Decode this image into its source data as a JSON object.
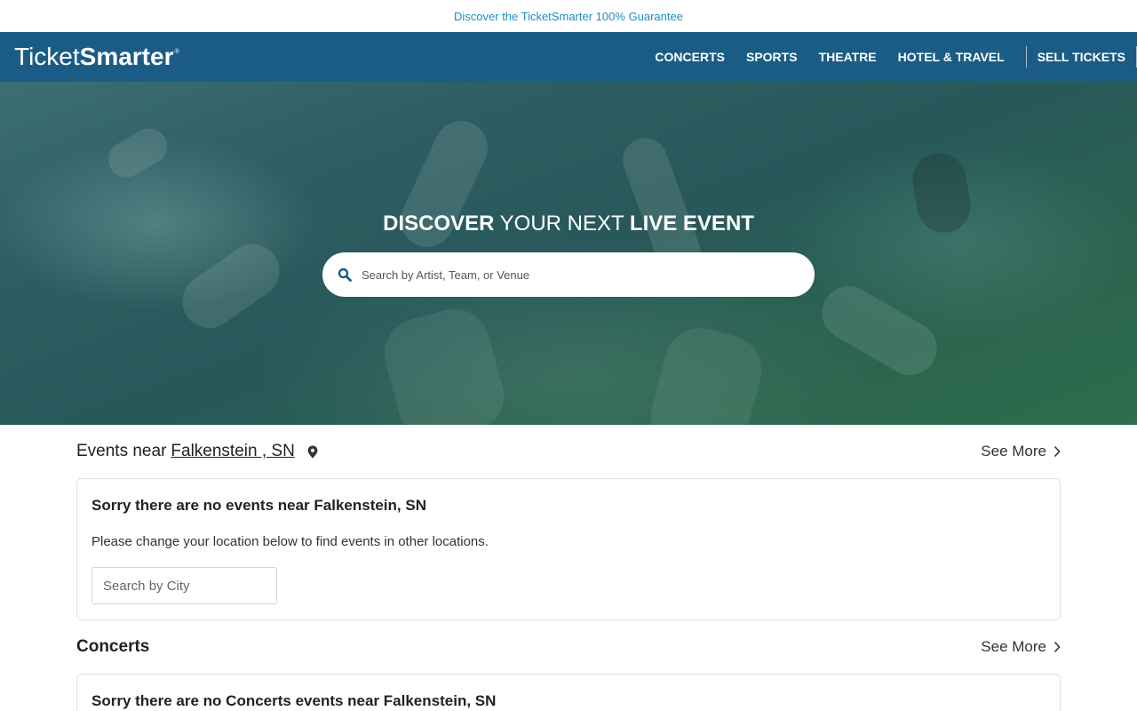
{
  "promo": {
    "text": "Discover the TicketSmarter 100% Guarantee"
  },
  "header": {
    "logo": {
      "part1": "Ticket",
      "part2": "Smarter",
      "mark": "®"
    },
    "nav": [
      "CONCERTS",
      "SPORTS",
      "THEATRE",
      "HOTEL & TRAVEL"
    ],
    "sell": "SELL TICKETS"
  },
  "hero": {
    "title_part1": "DISCOVER",
    "title_part2": " YOUR NEXT ",
    "title_part3": "LIVE EVENT",
    "search_placeholder": "Search by Artist, Team, or Venue",
    "search_icon": "search-icon"
  },
  "events_near": {
    "label": "Events near",
    "location": "Falkenstein , SN",
    "pin_icon": "map-pin-icon",
    "see_more": "See More",
    "empty_title": "Sorry there are no events near Falkenstein, SN",
    "empty_text": "Please change your location below to find events in other locations.",
    "city_placeholder": "Search by City"
  },
  "concerts": {
    "title": "Concerts",
    "see_more": "See More",
    "empty_title": "Sorry there are no Concerts events near Falkenstein, SN"
  },
  "colors": {
    "nav_bg": "#1b5c86",
    "promo_link": "#1a8fc4",
    "search_icon": "#1b5c86"
  }
}
